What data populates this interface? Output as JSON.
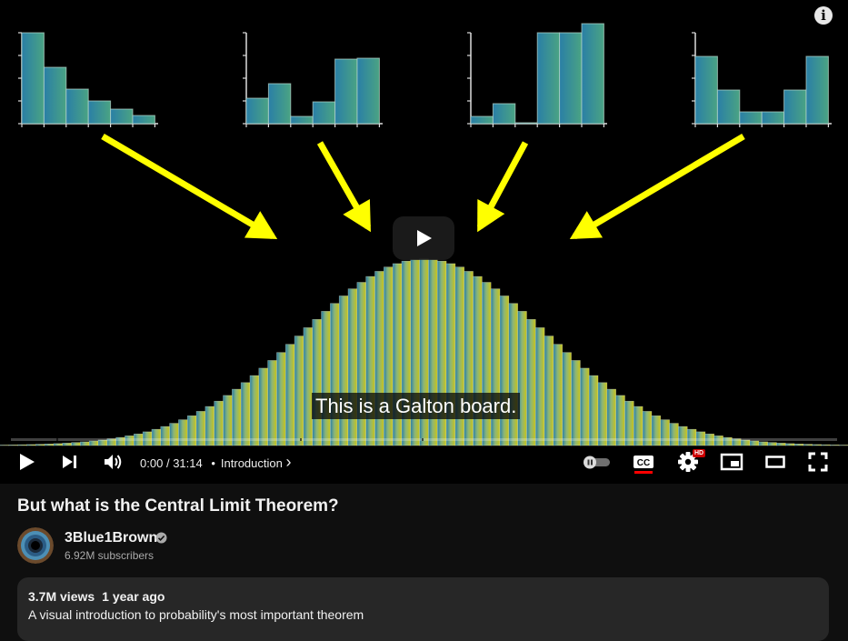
{
  "video": {
    "title": "But what is the Central Limit Theorem?",
    "caption": "This is a Galton board.",
    "time_current": "0:00",
    "time_separator": "/",
    "time_total": "31:14",
    "chapter_separator": "•",
    "chapter": "Introduction",
    "chapter_chevron": "›",
    "progress": 0,
    "info_glyph": "i",
    "hd_badge": "HD",
    "icons": [
      "info-icon",
      "play-icon",
      "next-icon",
      "volume-icon",
      "autoplay-toggle-icon",
      "captions-icon",
      "settings-icon",
      "miniplayer-icon",
      "theater-mode-icon",
      "fullscreen-icon"
    ]
  },
  "channel": {
    "name": "3Blue1Brown",
    "subscribers": "6.92M subscribers",
    "verified": true
  },
  "description": {
    "views": "3.7M views",
    "age": "1 year ago",
    "text": "A visual introduction to probability's most important theorem"
  },
  "scene_data": {
    "small_histograms": [
      [
        1.0,
        0.62,
        0.38,
        0.25,
        0.16,
        0.09
      ],
      [
        0.28,
        0.44,
        0.08,
        0.24,
        0.71,
        0.72
      ],
      [
        0.08,
        0.22,
        0.01,
        1.0,
        1.0,
        1.1
      ],
      [
        0.74,
        0.37,
        0.13,
        0.13,
        0.37,
        0.74
      ]
    ],
    "bell_bins": 95,
    "accent_colors": {
      "teal": "#2a7fa6",
      "green": "#4aa383",
      "yellow": "#c9c419",
      "arrow": "#ffff00",
      "progress_red": "#ff0000"
    }
  }
}
